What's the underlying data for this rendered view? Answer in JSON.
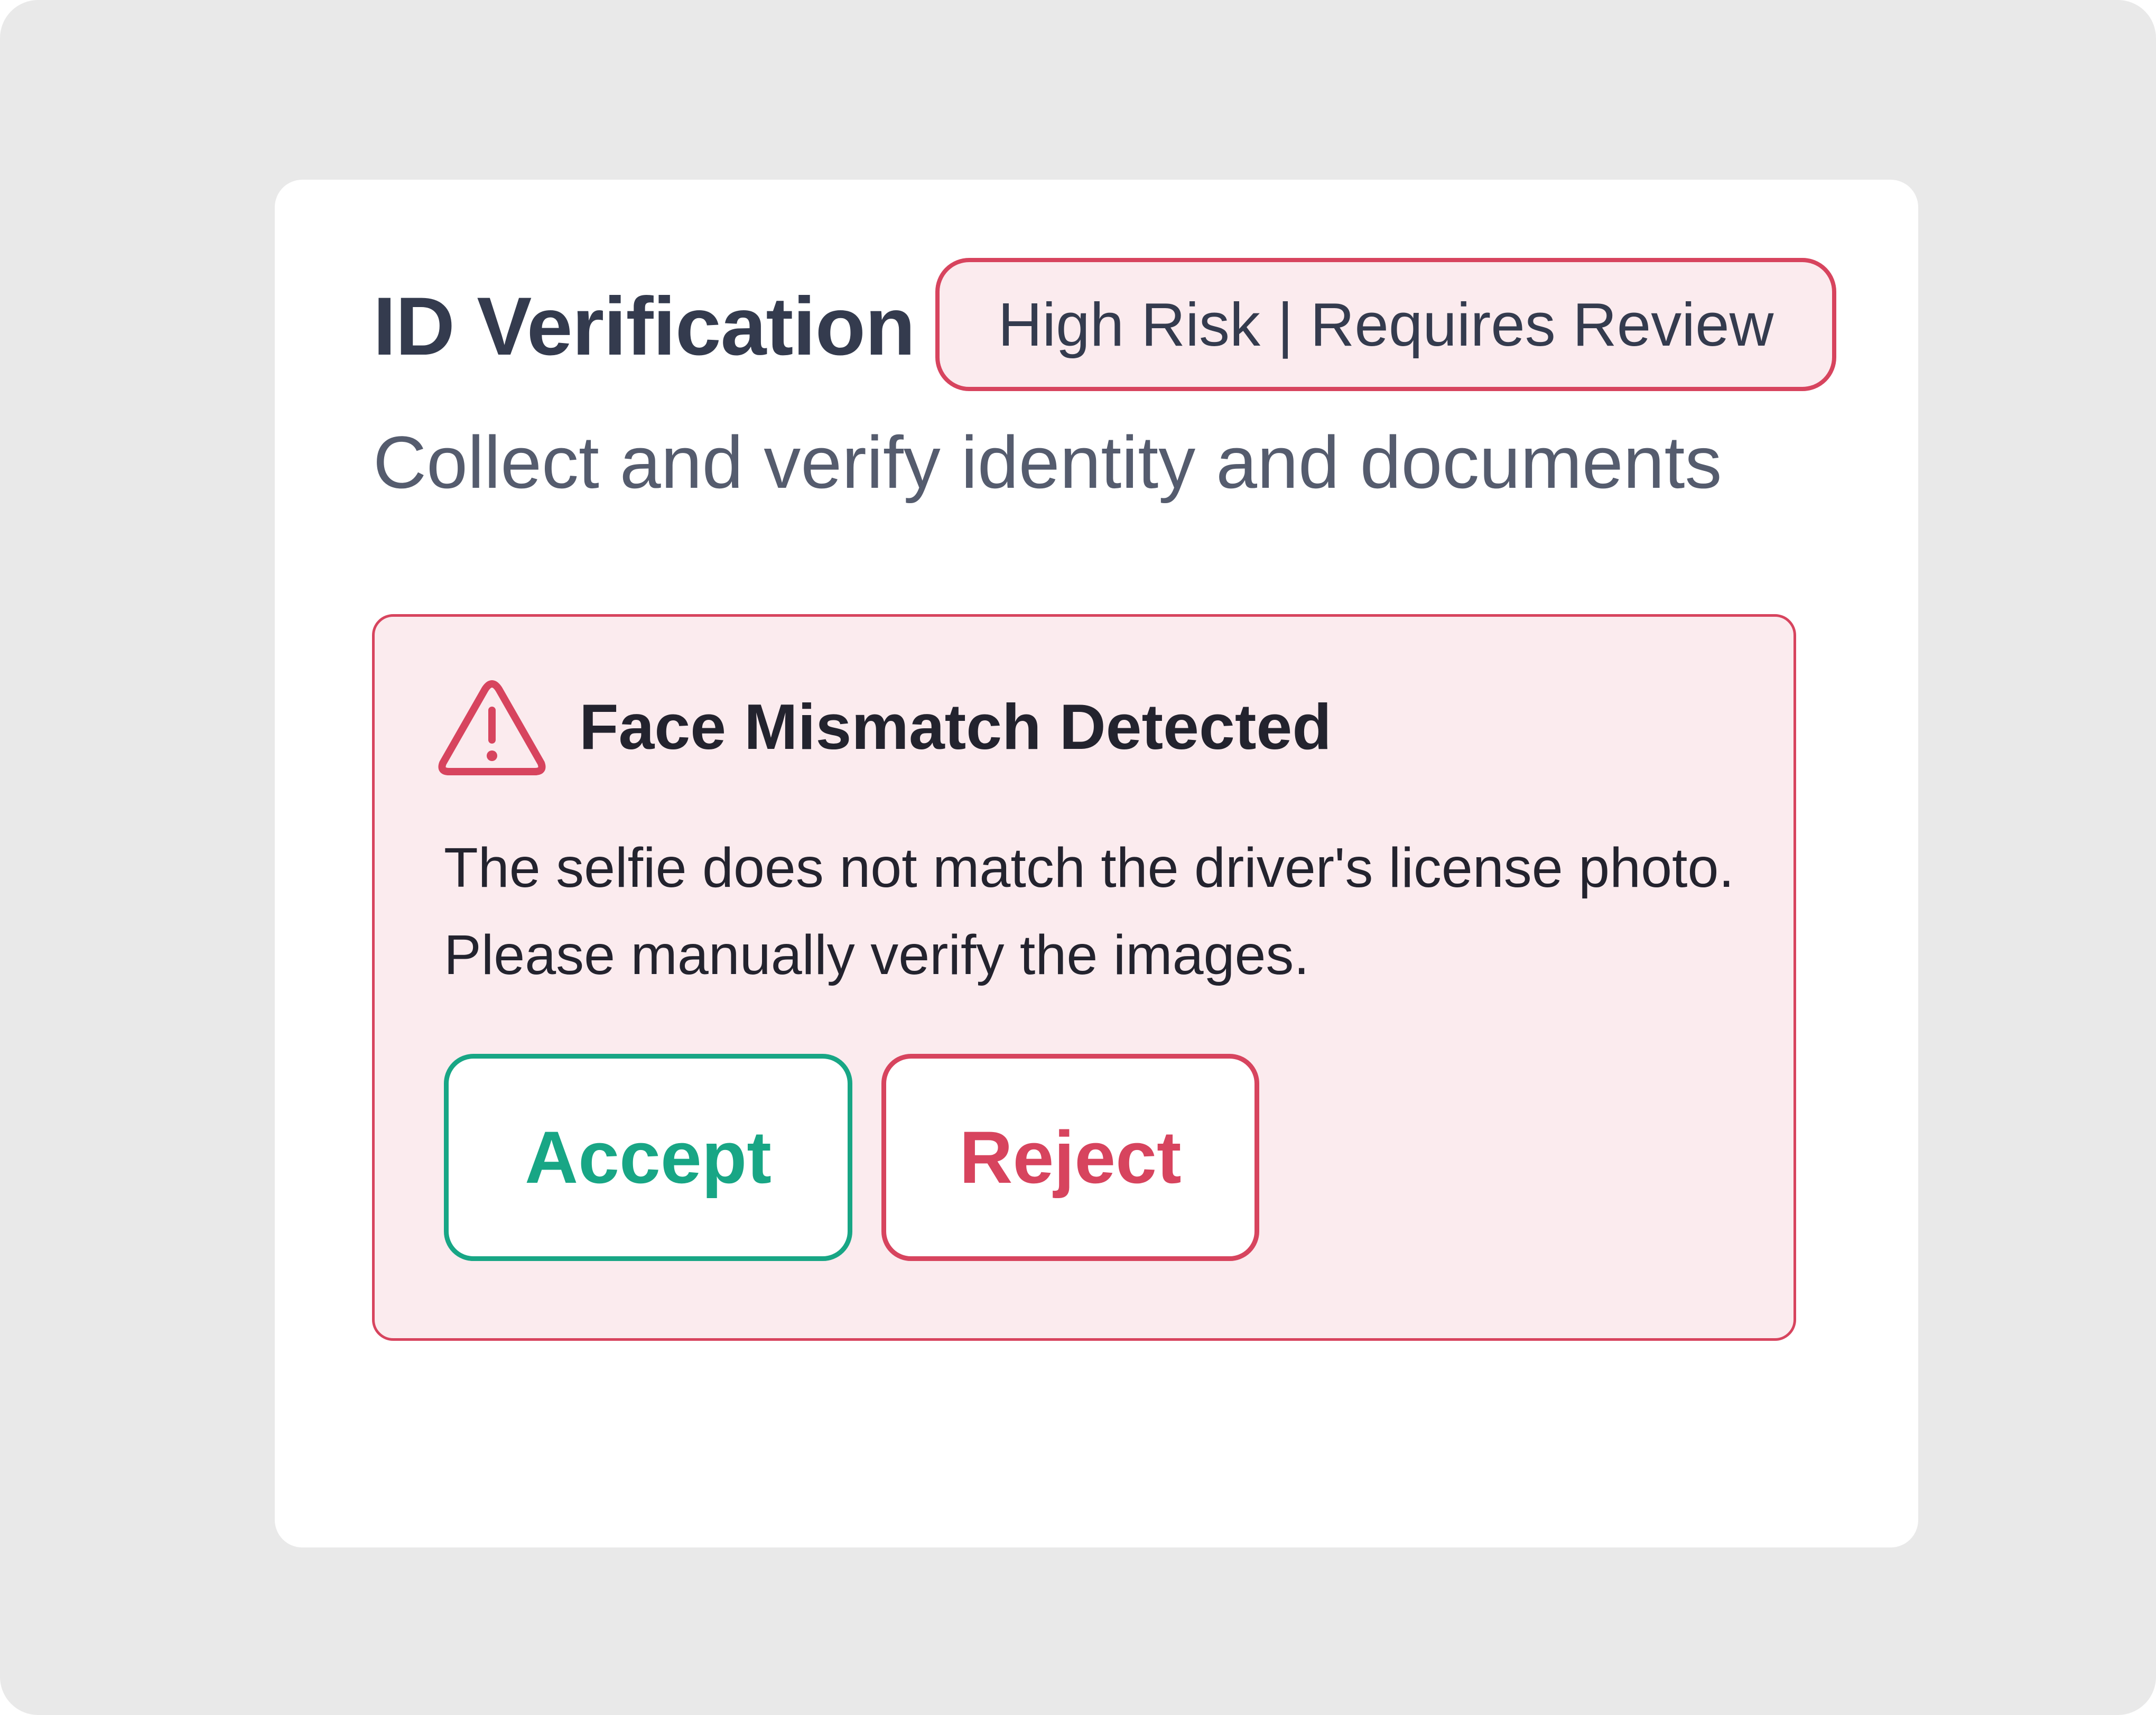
{
  "page": {
    "title": "ID Verification",
    "risk_badge": "High Risk | Requires Review",
    "subtitle": "Collect and verify identity and documents"
  },
  "alert": {
    "icon": "warning-triangle-icon",
    "title": "Face Mismatch Detected",
    "message": "The selfie does not match the driver's license photo. Please manually verify the images.",
    "actions": {
      "accept_label": "Accept",
      "reject_label": "Reject"
    }
  },
  "colors": {
    "background": "#e9e9e9",
    "card": "#ffffff",
    "danger": "#d7445e",
    "danger_bg": "#fbebee",
    "success": "#18a685",
    "heading": "#343b4e",
    "muted": "#555c6e",
    "text": "#23232e"
  }
}
